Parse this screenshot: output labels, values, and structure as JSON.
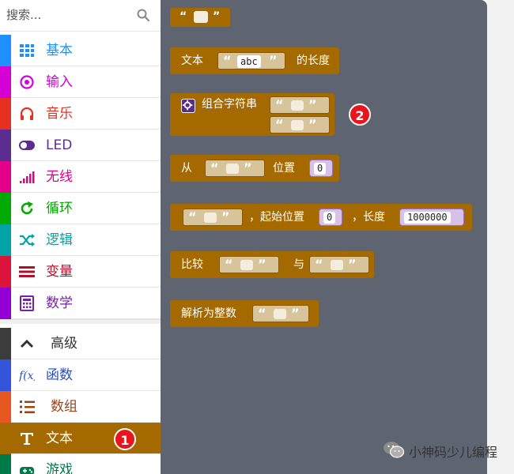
{
  "search": {
    "placeholder": "搜索..."
  },
  "categories": [
    {
      "label": "基本",
      "color": "#1e90ff",
      "icon": "grid-icon"
    },
    {
      "label": "输入",
      "color": "#d400d4",
      "icon": "radio-target-icon"
    },
    {
      "label": "音乐",
      "color": "#e63022",
      "icon": "headphones-icon"
    },
    {
      "label": "LED",
      "color": "#5c2d91",
      "icon": "toggle-icon"
    },
    {
      "label": "无线",
      "color": "#e3008c",
      "icon": "signal-bars-icon"
    },
    {
      "label": "循环",
      "color": "#00aa00",
      "icon": "refresh-icon"
    },
    {
      "label": "逻辑",
      "color": "#00a4a6",
      "icon": "shuffle-icon"
    },
    {
      "label": "变量",
      "color": "#dc143c",
      "icon": "list-lines-icon"
    },
    {
      "label": "数学",
      "color": "#9400d3",
      "icon": "calculator-icon"
    },
    {
      "label": "高级",
      "color": "#3c3c3c",
      "icon": "chevron-up-icon"
    },
    {
      "label": "函数",
      "color": "#3455db",
      "icon": "function-icon"
    },
    {
      "label": "数组",
      "color": "#e65722",
      "icon": "numbered-list-icon"
    },
    {
      "label": "文本",
      "color": "#b8860b",
      "icon": "text-t-icon"
    },
    {
      "label": "游戏",
      "color": "#007a4b",
      "icon": "gamepad-icon"
    }
  ],
  "badges": {
    "one": "1",
    "two": "2"
  },
  "blocks": {
    "string_literal": {
      "open": "“",
      "close": "”"
    },
    "length": {
      "prefix": "文本",
      "value": "abc",
      "suffix": "的长度"
    },
    "join": {
      "label": "组合字符串"
    },
    "char_at": {
      "prefix": "从",
      "middle": "位置",
      "index": "0"
    },
    "substr": {
      "start_label": "，起始位置",
      "start": "0",
      "length_label": "，长度",
      "length": "1000000"
    },
    "compare": {
      "prefix": "比较",
      "middle": "与"
    },
    "parse": {
      "label": "解析为整数"
    }
  },
  "watermark": {
    "text": "小神码少儿编程",
    "icon": "wechat-icon"
  }
}
